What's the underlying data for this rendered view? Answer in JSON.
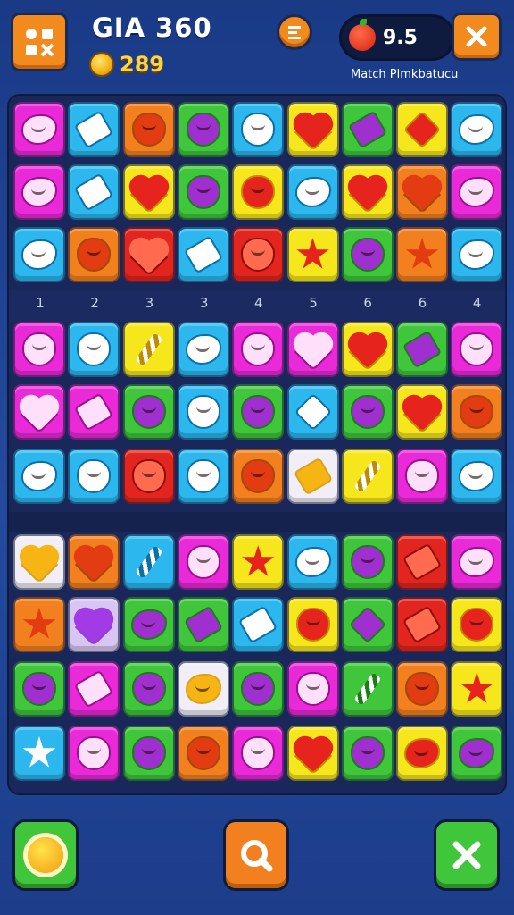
{
  "header": {
    "title": "GIA 360",
    "coins": "289",
    "moves": "9.5",
    "subtitle": "Match Plmkbatucu",
    "menu_icon": "grid-menu-icon",
    "center_icon": "list-icon",
    "close_icon": "close-icon"
  },
  "row_labels": [
    "1",
    "2",
    "3",
    "3",
    "4",
    "5",
    "6",
    "6",
    "4"
  ],
  "palette": {
    "magenta": "#ea2ad8",
    "cyan": "#2cb8ef",
    "orange": "#f2801f",
    "green": "#3fc63a",
    "yellow": "#f6e71c",
    "red": "#e2261f",
    "white": "#f1eef7",
    "lavender": "#d8c6f2"
  },
  "board": {
    "rows": [
      [
        [
          "magenta",
          "blob"
        ],
        [
          "cyan",
          "block"
        ],
        [
          "orange",
          "apple"
        ],
        [
          "green",
          "apple"
        ],
        [
          "cyan",
          "apple"
        ],
        [
          "yellow",
          "heart"
        ],
        [
          "green",
          "block"
        ],
        [
          "yellow",
          "gem"
        ],
        [
          "cyan",
          "blob"
        ]
      ],
      [
        [
          "magenta",
          "blob"
        ],
        [
          "cyan",
          "block"
        ],
        [
          "yellow",
          "heart"
        ],
        [
          "green",
          "apple"
        ],
        [
          "yellow",
          "apple"
        ],
        [
          "cyan",
          "blob"
        ],
        [
          "yellow",
          "heart"
        ],
        [
          "orange",
          "heart"
        ],
        [
          "magenta",
          "blob"
        ]
      ],
      [
        [
          "cyan",
          "blob"
        ],
        [
          "orange",
          "apple"
        ],
        [
          "red",
          "heart"
        ],
        [
          "cyan",
          "block"
        ],
        [
          "red",
          "apple"
        ],
        [
          "yellow",
          "star"
        ],
        [
          "green",
          "apple"
        ],
        [
          "orange",
          "star"
        ],
        [
          "cyan",
          "blob"
        ]
      ],
      [
        [
          "magenta",
          "apple"
        ],
        [
          "cyan",
          "apple"
        ],
        [
          "yellow",
          "stripe"
        ],
        [
          "cyan",
          "blob"
        ],
        [
          "magenta",
          "apple"
        ],
        [
          "magenta",
          "heart"
        ],
        [
          "yellow",
          "heart"
        ],
        [
          "green",
          "block"
        ],
        [
          "magenta",
          "apple"
        ]
      ],
      [
        [
          "magenta",
          "heart"
        ],
        [
          "magenta",
          "block"
        ],
        [
          "green",
          "apple"
        ],
        [
          "cyan",
          "apple"
        ],
        [
          "green",
          "apple"
        ],
        [
          "cyan",
          "gem"
        ],
        [
          "green",
          "apple"
        ],
        [
          "yellow",
          "heart"
        ],
        [
          "orange",
          "apple"
        ]
      ],
      [
        [
          "cyan",
          "blob"
        ],
        [
          "cyan",
          "apple"
        ],
        [
          "red",
          "apple"
        ],
        [
          "cyan",
          "apple"
        ],
        [
          "orange",
          "apple"
        ],
        [
          "white",
          "block"
        ],
        [
          "yellow",
          "stripe"
        ],
        [
          "magenta",
          "apple"
        ],
        [
          "cyan",
          "blob"
        ]
      ],
      [
        [
          "white",
          "heart"
        ],
        [
          "orange",
          "heart"
        ],
        [
          "cyan",
          "stripe"
        ],
        [
          "magenta",
          "apple"
        ],
        [
          "yellow",
          "star"
        ],
        [
          "cyan",
          "blob"
        ],
        [
          "green",
          "apple"
        ],
        [
          "red",
          "block"
        ],
        [
          "magenta",
          "blob"
        ]
      ],
      [
        [
          "orange",
          "star"
        ],
        [
          "lavender",
          "heart"
        ],
        [
          "green",
          "blob"
        ],
        [
          "green",
          "block"
        ],
        [
          "cyan",
          "block"
        ],
        [
          "yellow",
          "apple"
        ],
        [
          "green",
          "gem"
        ],
        [
          "red",
          "block"
        ],
        [
          "yellow",
          "apple"
        ]
      ],
      [
        [
          "green",
          "apple"
        ],
        [
          "magenta",
          "block"
        ],
        [
          "green",
          "apple"
        ],
        [
          "white",
          "blob"
        ],
        [
          "green",
          "apple"
        ],
        [
          "magenta",
          "apple"
        ],
        [
          "green",
          "stripe"
        ],
        [
          "orange",
          "apple"
        ],
        [
          "yellow",
          "star"
        ]
      ],
      [
        [
          "cyan",
          "star"
        ],
        [
          "magenta",
          "apple"
        ],
        [
          "green",
          "apple"
        ],
        [
          "orange",
          "apple"
        ],
        [
          "magenta",
          "apple"
        ],
        [
          "yellow",
          "heart"
        ],
        [
          "green",
          "apple"
        ],
        [
          "yellow",
          "blob"
        ],
        [
          "green",
          "blob"
        ]
      ]
    ]
  },
  "bottom_bar": {
    "left_icon": "sun-icon",
    "center_icon": "search-icon",
    "right_icon": "close-icon"
  }
}
